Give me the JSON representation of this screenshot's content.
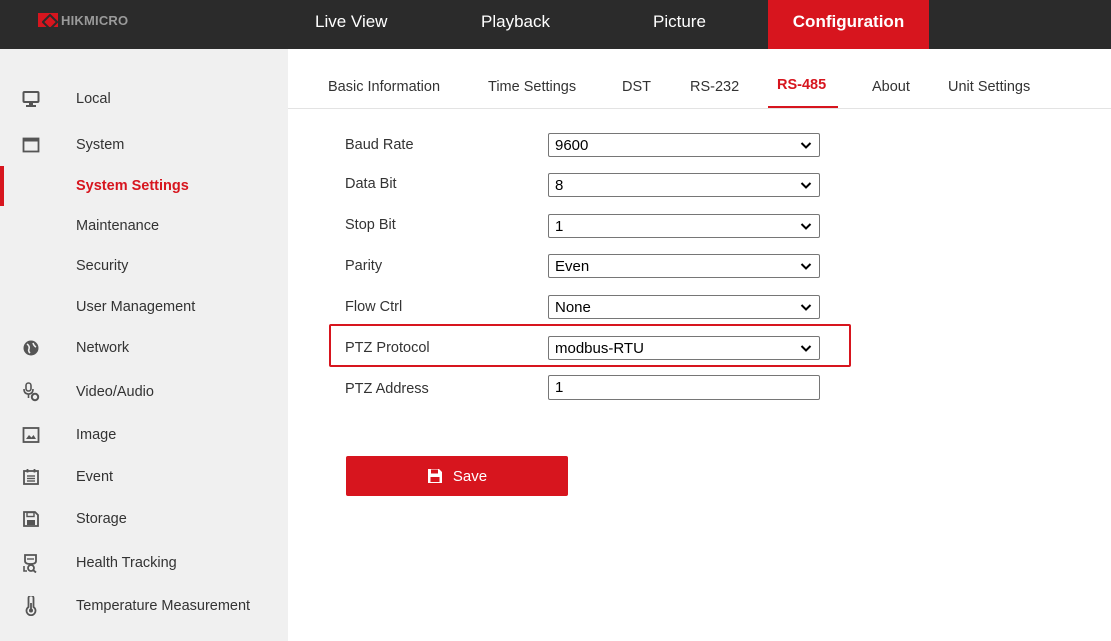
{
  "brand": {
    "name": "HIKMICRO"
  },
  "topnav": {
    "items": [
      {
        "label": "Live View"
      },
      {
        "label": "Playback"
      },
      {
        "label": "Picture"
      },
      {
        "label": "Configuration"
      }
    ]
  },
  "sidebar": {
    "items": [
      {
        "label": "Local",
        "icon": "monitor-icon"
      },
      {
        "label": "System",
        "icon": "window-icon"
      },
      {
        "label": "System Settings"
      },
      {
        "label": "Maintenance"
      },
      {
        "label": "Security"
      },
      {
        "label": "User Management"
      },
      {
        "label": "Network",
        "icon": "globe-icon"
      },
      {
        "label": "Video/Audio",
        "icon": "microphone-icon"
      },
      {
        "label": "Image",
        "icon": "image-icon"
      },
      {
        "label": "Event",
        "icon": "calendar-icon"
      },
      {
        "label": "Storage",
        "icon": "floppy-icon"
      },
      {
        "label": "Health Tracking",
        "icon": "health-tracking-icon"
      },
      {
        "label": "Temperature Measurement",
        "icon": "thermometer-icon"
      }
    ]
  },
  "tabs": [
    {
      "label": "Basic Information"
    },
    {
      "label": "Time Settings"
    },
    {
      "label": "DST"
    },
    {
      "label": "RS-232"
    },
    {
      "label": "RS-485"
    },
    {
      "label": "About"
    },
    {
      "label": "Unit Settings"
    }
  ],
  "form": {
    "baud_rate": {
      "label": "Baud Rate",
      "value": "9600"
    },
    "data_bit": {
      "label": "Data Bit",
      "value": "8"
    },
    "stop_bit": {
      "label": "Stop Bit",
      "value": "1"
    },
    "parity": {
      "label": "Parity",
      "value": "Even"
    },
    "flow_ctrl": {
      "label": "Flow Ctrl",
      "value": "None"
    },
    "ptz_protocol": {
      "label": "PTZ Protocol",
      "value": "modbus-RTU"
    },
    "ptz_address": {
      "label": "PTZ Address",
      "value": "1"
    }
  },
  "actions": {
    "save_label": "Save"
  },
  "colors": {
    "accent": "#d7151e",
    "topbar": "#2b2b2b",
    "sidebar": "#f0f0f0"
  }
}
